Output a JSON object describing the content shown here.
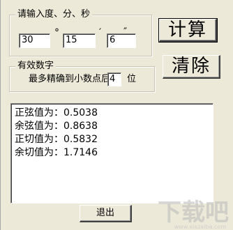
{
  "input_group": {
    "legend": "请输入度、分、秒",
    "degree_value": "30",
    "degree_symbol": "°",
    "minute_value": "15",
    "minute_symbol": "′",
    "second_value": "6",
    "second_symbol": "″"
  },
  "precision_group": {
    "legend": "有效数字",
    "prefix_label": "最多精确到小数点后",
    "digits_value": "4",
    "suffix_label": "位"
  },
  "buttons": {
    "calculate": "计算",
    "clear": "清除",
    "exit": "退出"
  },
  "results": [
    {
      "label": "正弦值为：",
      "value": "0.5038"
    },
    {
      "label": "余弦值为：",
      "value": "0.8638"
    },
    {
      "label": "正切值为：",
      "value": "0.5832"
    },
    {
      "label": "余切值为：",
      "value": "1.7146"
    }
  ],
  "watermark": {
    "text": "下载吧",
    "url": "www.xiazaiba.com"
  }
}
